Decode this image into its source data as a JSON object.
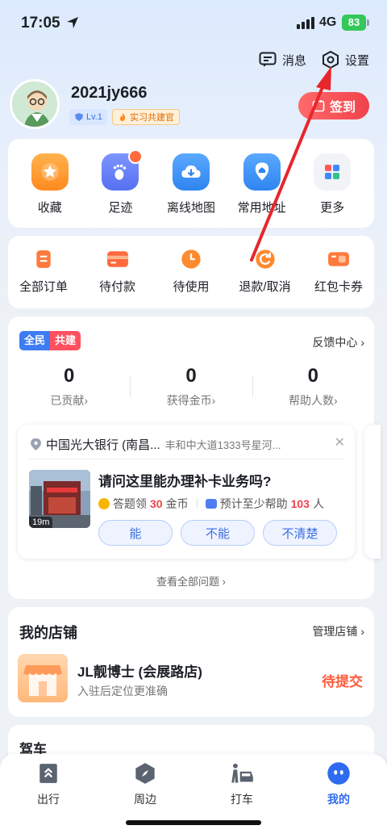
{
  "status_bar": {
    "time": "17:05",
    "network": "4G",
    "battery": "83"
  },
  "top_actions": {
    "messages_label": "消息",
    "settings_label": "设置"
  },
  "profile": {
    "username": "2021jy666",
    "level": "Lv.1",
    "role_badge": "实习共建官",
    "signin_label": "签到"
  },
  "quick_grid": [
    {
      "label": "收藏",
      "icon": "star-icon",
      "color": "#ff9a2e"
    },
    {
      "label": "足迹",
      "icon": "footprint-icon",
      "color": "#5b7cf5"
    },
    {
      "label": "离线地图",
      "icon": "download-cloud-icon",
      "color": "#2f8df5"
    },
    {
      "label": "常用地址",
      "icon": "home-pin-icon",
      "color": "#2f8df5"
    },
    {
      "label": "更多",
      "icon": "grid-icon",
      "color": "#f1f3f7"
    }
  ],
  "orders": [
    {
      "label": "全部订单",
      "icon": "order-list-icon"
    },
    {
      "label": "待付款",
      "icon": "wallet-icon"
    },
    {
      "label": "待使用",
      "icon": "clock-icon"
    },
    {
      "label": "退款/取消",
      "icon": "refund-icon"
    },
    {
      "label": "红包卡券",
      "icon": "coupon-icon"
    }
  ],
  "cobuild": {
    "tag_a": "全民",
    "tag_b": "共建",
    "feedback_label": "反馈中心 ›",
    "stats": [
      {
        "value": "0",
        "label": "已贡献›"
      },
      {
        "value": "0",
        "label": "获得金币›"
      },
      {
        "value": "0",
        "label": "帮助人数›"
      }
    ],
    "question": {
      "poi": "中国光大银行 (南昌...",
      "address": "丰和中大道1333号星河...",
      "distance": "19m",
      "title": "请问这里能办理补卡业务吗?",
      "reward_prefix": "答题领",
      "reward_value": "30",
      "reward_unit": "金币",
      "help_prefix": "预计至少帮助",
      "help_value": "103",
      "help_unit": "人",
      "answers": [
        "能",
        "不能",
        "不清楚"
      ]
    },
    "all_questions_label": "查看全部问题 ›"
  },
  "shop": {
    "title": "我的店铺",
    "manage_label": "管理店铺 ›",
    "name": "JL靓博士 (会展路店)",
    "subtitle": "入驻后定位更准确",
    "status": "待提交"
  },
  "drive": {
    "title": "驾车"
  },
  "tabbar": [
    {
      "label": "出行",
      "icon": "travel-icon",
      "active": false
    },
    {
      "label": "周边",
      "icon": "compass-icon",
      "active": false
    },
    {
      "label": "打车",
      "icon": "taxi-icon",
      "active": false
    },
    {
      "label": "我的",
      "icon": "profile-face-icon",
      "active": true
    }
  ],
  "colors": {
    "accent": "#2f6bf0",
    "signin": "#f0424c",
    "annotation": "#e8262b"
  }
}
